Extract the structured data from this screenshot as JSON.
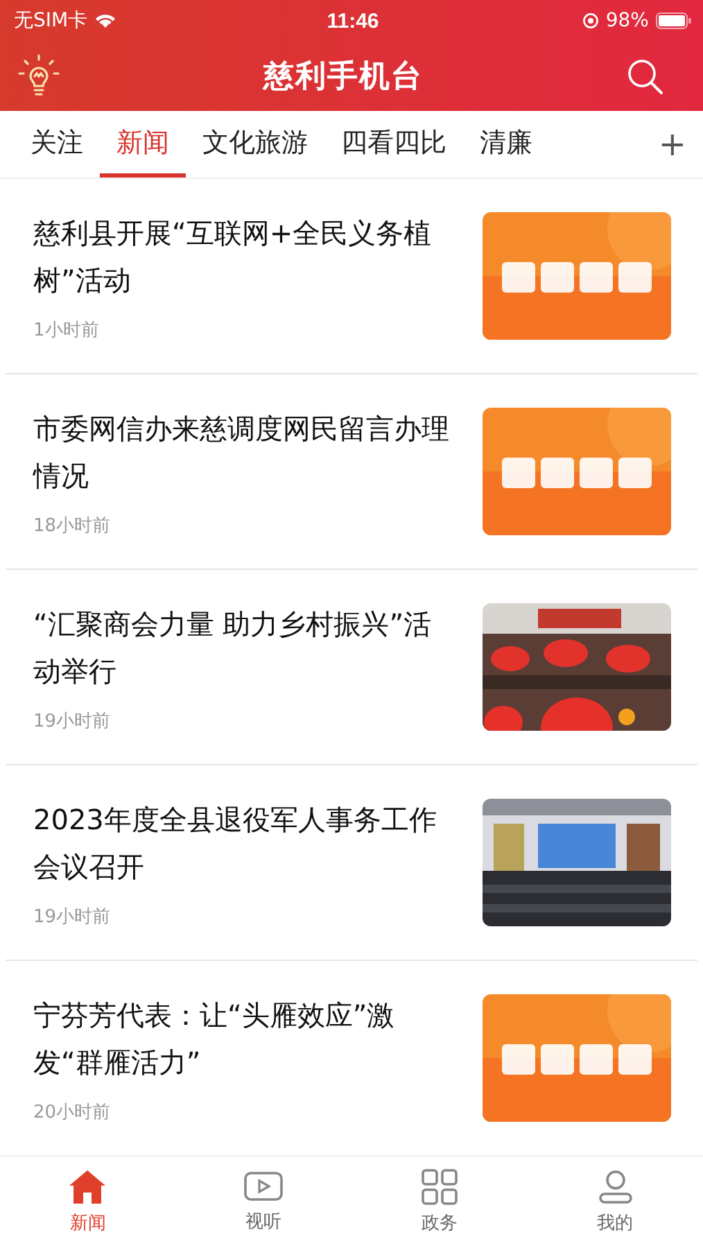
{
  "status_bar": {
    "carrier": "无SIM卡",
    "time": "11:46",
    "battery": "98%"
  },
  "header": {
    "title": "慈利手机台"
  },
  "tabs": [
    {
      "label": "关注",
      "selected": false
    },
    {
      "label": "新闻",
      "selected": true
    },
    {
      "label": "文化旅游",
      "selected": false
    },
    {
      "label": "四看四比",
      "selected": false
    },
    {
      "label": "清廉",
      "selected": false
    }
  ],
  "add_tab": "+",
  "articles": [
    {
      "title": "慈利县开展“互联网+全民义务植树”活动",
      "time": "1小时前"
    },
    {
      "title": "市委网信办来慈调度网民留言办理情况",
      "time": "18小时前"
    },
    {
      "title": "“汇聚商会力量 助力乡村振兴”活动举行",
      "time": "19小时前"
    },
    {
      "title": "2023年度全县退役军人事务工作会议召开",
      "time": "19小时前"
    },
    {
      "title": "宁芬芳代表：让“头雁效应”激发“群雁活力”",
      "time": "20小时前"
    }
  ],
  "bottom_nav": [
    {
      "label": "新闻",
      "kind": "home",
      "selected": true
    },
    {
      "label": "视听",
      "kind": "play",
      "selected": false
    },
    {
      "label": "政务",
      "kind": "grid",
      "selected": false
    },
    {
      "label": "我的",
      "kind": "user",
      "selected": false
    }
  ]
}
